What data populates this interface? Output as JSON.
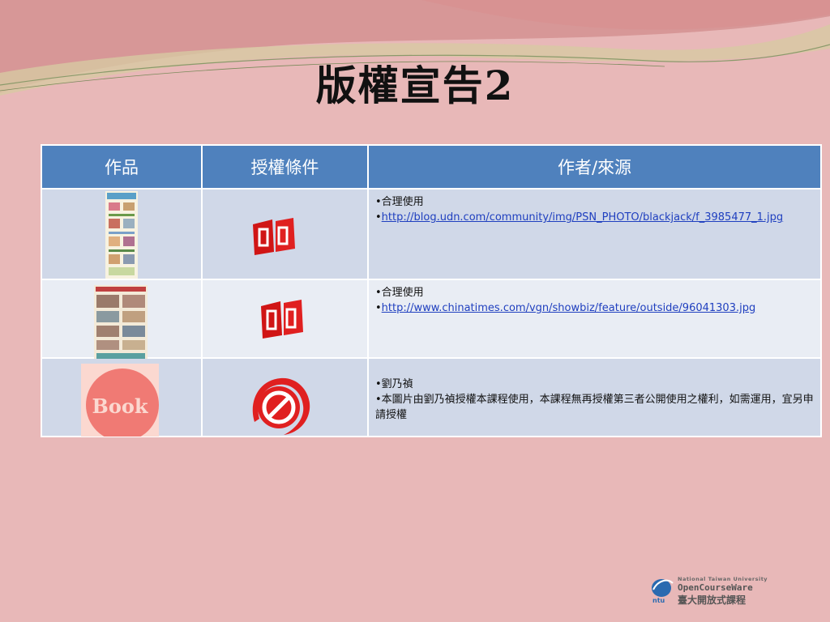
{
  "title": "版權宣告2",
  "table": {
    "headers": [
      "作品",
      "授權條件",
      "作者/來源"
    ],
    "rows": [
      {
        "work_icon": "magazine-page-thumbnail",
        "license_icon": "open-book-icon",
        "source_lines": [
          "•合理使用"
        ],
        "source_link": "http://blog.udn.com/community/img/PSN_PHOTO/blackjack/f_3985477_1.jpg"
      },
      {
        "work_icon": "newspaper-page-thumbnail",
        "license_icon": "open-book-icon",
        "source_lines": [
          "•合理使用"
        ],
        "source_link": "http://www.chinatimes.com/vgn/showbiz/feature/outside/96041303.jpg"
      },
      {
        "work_icon": "book-logo-thumbnail",
        "work_label": "Book",
        "license_icon": "no-entry-icon",
        "source_lines": [
          "•劉乃禎",
          "•本圖片由劉乃禎授權本課程使用，本課程無再授權第三者公開使用之權利，如需運用，宜另申請授權"
        ]
      }
    ]
  },
  "footer_logo": {
    "line1": "National Taiwan University",
    "line2": "OpenCourseWare",
    "line3": "臺大開放式課程",
    "badge": "ntu"
  },
  "colors": {
    "header": "#4f81bd",
    "row_odd": "#d0d8e8",
    "row_even": "#e9edf4",
    "background": "#e8b8b8",
    "link": "#1f3fbf"
  }
}
